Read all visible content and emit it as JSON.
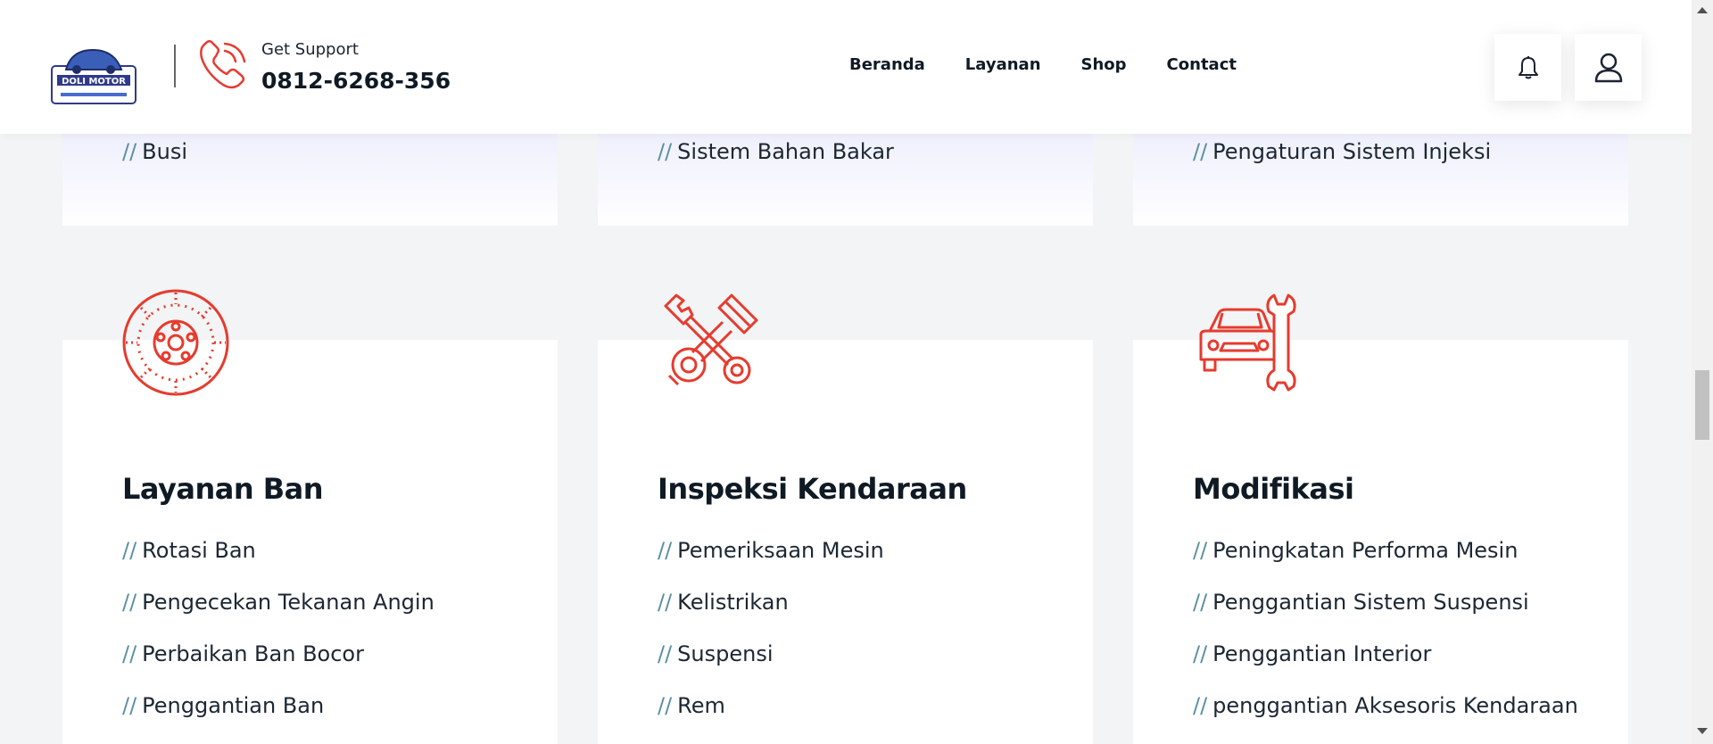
{
  "header": {
    "logo_text": "DOLI MOTOR",
    "support_label": "Get Support",
    "support_phone": "0812-6268-356",
    "nav": [
      "Beranda",
      "Layanan",
      "Shop",
      "Contact"
    ],
    "icons": {
      "phone": "phone-icon",
      "bell": "bell-icon",
      "user": "user-icon"
    }
  },
  "top_cards": [
    {
      "item": "Busi"
    },
    {
      "item": "Sistem Bahan Bakar"
    },
    {
      "item": "Pengaturan Sistem Injeksi"
    }
  ],
  "services": [
    {
      "icon": "brake-disc-icon",
      "title": "Layanan Ban",
      "items": [
        "Rotasi Ban",
        "Pengecekan Tekanan Angin",
        "Perbaikan Ban Bocor",
        "Penggantian Ban"
      ]
    },
    {
      "icon": "wrench-piston-icon",
      "title": "Inspeksi Kendaraan",
      "items": [
        "Pemeriksaan Mesin",
        "Kelistrikan",
        "Suspensi",
        "Rem"
      ]
    },
    {
      "icon": "car-wrench-icon",
      "title": "Modifikasi",
      "items": [
        "Peningkatan Performa Mesin",
        "Penggantian Sistem Suspensi",
        "Penggantian Interior",
        "penggantian Aksesoris Kendaraan"
      ]
    }
  ],
  "list_prefix": "//",
  "colors": {
    "accent": "#e63b2e",
    "prefix": "#5b8fa1",
    "top_card_tint": "#e6e8fb"
  }
}
